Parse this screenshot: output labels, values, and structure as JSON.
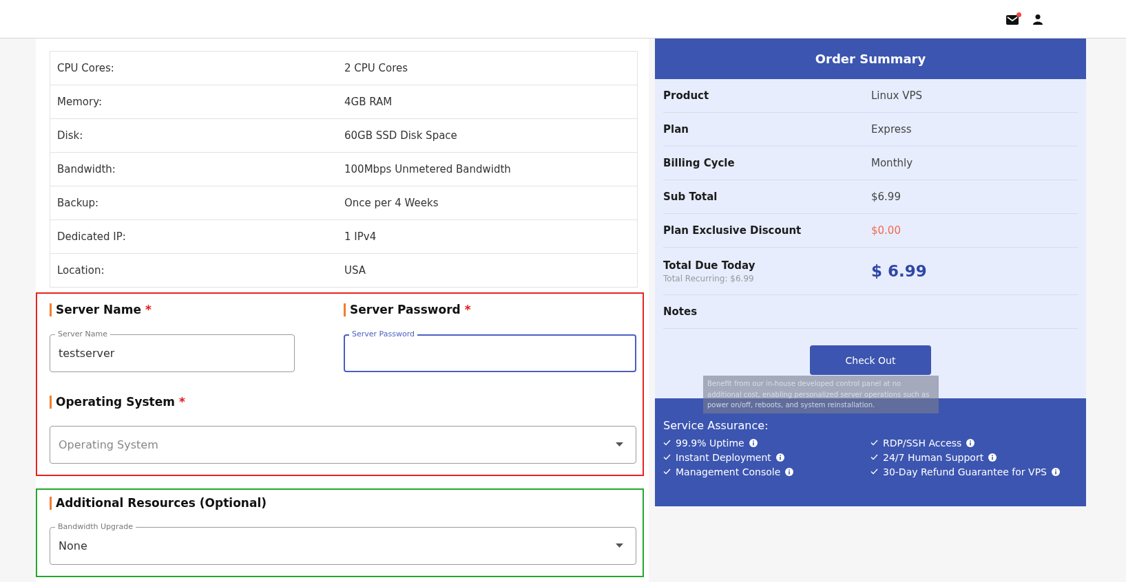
{
  "header": {
    "mail_unread": true
  },
  "specs": [
    {
      "label": "CPU Cores:",
      "value": "2 CPU Cores"
    },
    {
      "label": "Memory:",
      "value": "4GB RAM"
    },
    {
      "label": "Disk:",
      "value": "60GB SSD Disk Space"
    },
    {
      "label": "Bandwidth:",
      "value": "100Mbps Unmetered Bandwidth"
    },
    {
      "label": "Backup:",
      "value": "Once per 4 Weeks"
    },
    {
      "label": "Dedicated IP:",
      "value": "1 IPv4"
    },
    {
      "label": "Location:",
      "value": "USA"
    }
  ],
  "sections": [
    {
      "color": "#e8231f",
      "fields": [
        {
          "kind": "text",
          "heading": "Server Name",
          "required_mark": "*",
          "label": "Server Name",
          "value": "testserver",
          "focused": false
        },
        {
          "kind": "text",
          "heading": "Server Password",
          "required_mark": "*",
          "label": "Server Password",
          "focused": true
        },
        {
          "kind": "select",
          "heading": "Operating System",
          "required_mark": "*",
          "placeholder": "Operating System",
          "focused": false
        }
      ]
    },
    {
      "color": "#22a82a",
      "heading": "Additional Resources (Optional)",
      "fields": [
        {
          "kind": "select",
          "label": "Bandwidth Upgrade",
          "value": "None",
          "focused": false
        }
      ]
    }
  ],
  "order_summary": {
    "title": "Order Summary",
    "rows": [
      {
        "kind": "plain",
        "label": "Product",
        "value": "Linux VPS"
      },
      {
        "kind": "plain",
        "label": "Plan",
        "value": "Express"
      },
      {
        "kind": "plain",
        "label": "Billing Cycle",
        "value": "Monthly"
      },
      {
        "kind": "plain",
        "label": "Sub Total",
        "value": "$6.99"
      },
      {
        "kind": "discount",
        "label": "Plan Exclusive Discount",
        "value": "$0.00"
      },
      {
        "kind": "total",
        "label": "Total Due Today",
        "sublabel": "Total Recurring: $6.99",
        "value": "$ 6.99"
      },
      {
        "kind": "plain",
        "label": "Notes"
      }
    ],
    "button": "Check Out"
  },
  "service_assurance": {
    "title": "Service Assurance:",
    "items": [
      {
        "text": "99.9% Uptime"
      },
      {
        "text": "RDP/SSH Access"
      },
      {
        "text": "Instant Deployment"
      },
      {
        "text": "24/7 Human Support"
      },
      {
        "text": "Management Console"
      },
      {
        "text": "30-Day Refund Guarantee for VPS"
      }
    ],
    "tooltip": "Benefit from our in-house developed control panel at no additional cost, enabling personalized server operations such as power on/off, reboots, and system reinstallation."
  }
}
